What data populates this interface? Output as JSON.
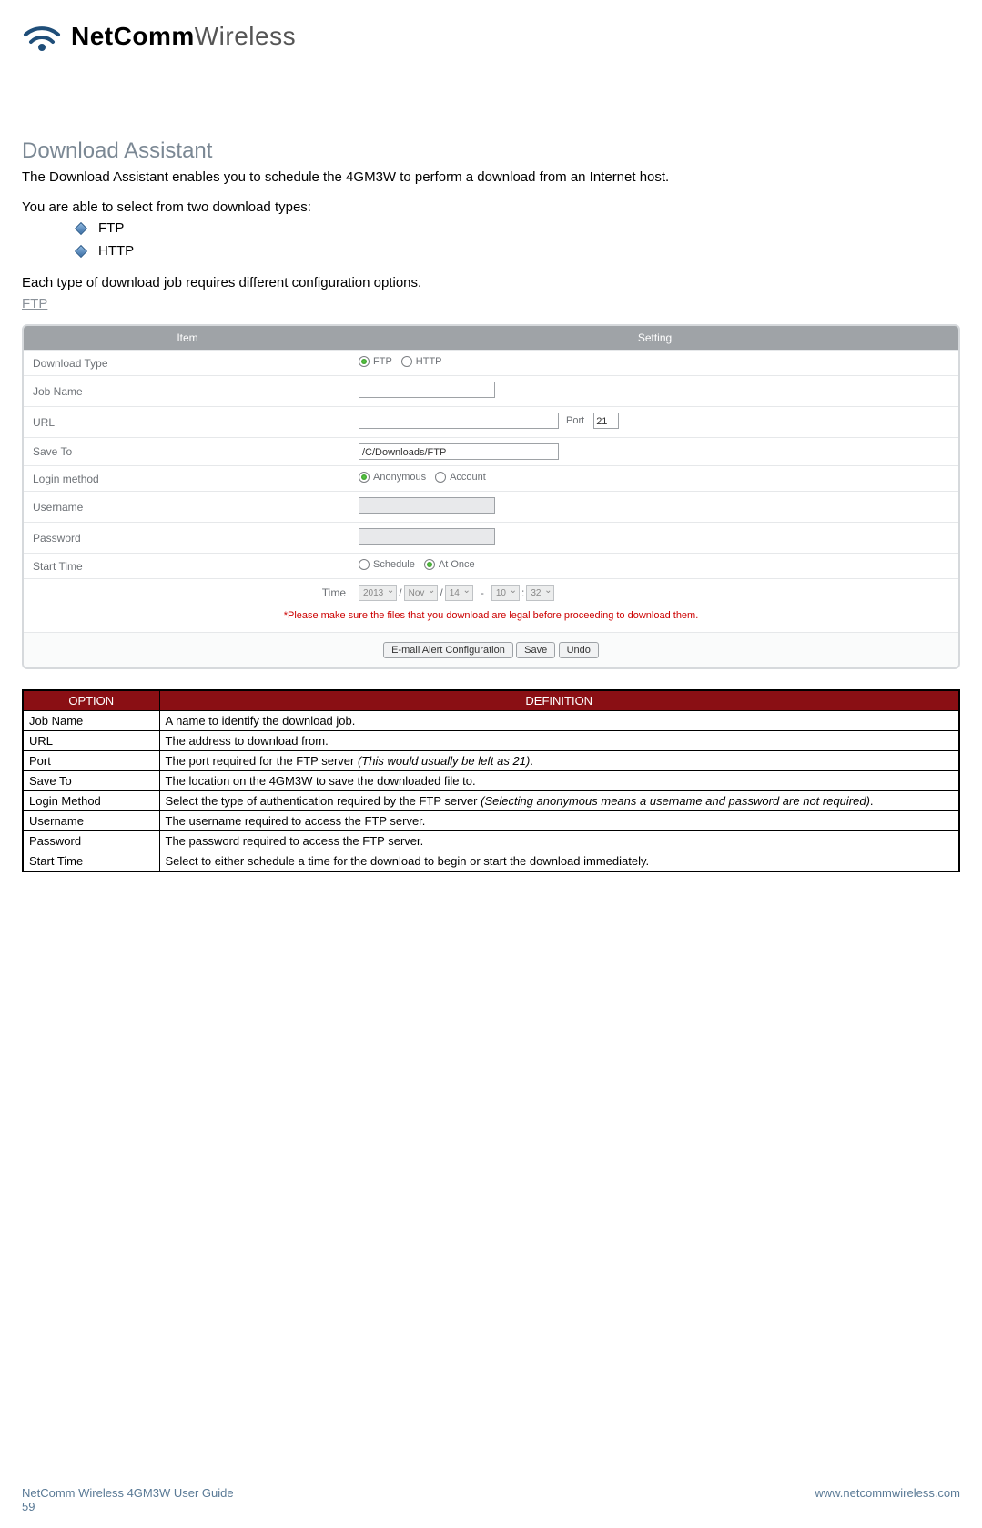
{
  "logo": {
    "bold": "NetComm",
    "light": "Wireless"
  },
  "title": "Download Assistant",
  "intro1": "The Download Assistant enables you to schedule the 4GM3W to perform a download from an Internet host.",
  "intro2": "You are able to select from two download types:",
  "bullets": [
    "FTP",
    "HTTP"
  ],
  "intro3": "Each type of download job requires different configuration options.",
  "subheading": "FTP",
  "settings": {
    "headers": {
      "item": "Item",
      "setting": "Setting"
    },
    "rows": {
      "download_type": {
        "label": "Download Type",
        "opt1": "FTP",
        "opt2": "HTTP"
      },
      "job_name": {
        "label": "Job Name"
      },
      "url": {
        "label": "URL",
        "port_label": "Port",
        "port_value": "21"
      },
      "save_to": {
        "label": "Save To",
        "value": "/C/Downloads/FTP"
      },
      "login_method": {
        "label": "Login method",
        "opt1": "Anonymous",
        "opt2": "Account"
      },
      "username": {
        "label": "Username"
      },
      "password": {
        "label": "Password"
      },
      "start_time": {
        "label": "Start Time",
        "opt1": "Schedule",
        "opt2": "At Once"
      },
      "time": {
        "label": "Time",
        "year": "2013",
        "month": "Nov",
        "day": "14",
        "hour": "10",
        "min": "32",
        "slash": "/",
        "dash": "-",
        "colon": ":"
      }
    },
    "warning": "*Please make sure the files that you download are legal before proceeding to download them.",
    "buttons": {
      "email": "E-mail Alert Configuration",
      "save": "Save",
      "undo": "Undo"
    }
  },
  "def_table": {
    "headers": {
      "option": "OPTION",
      "definition": "DEFINITION"
    },
    "rows": [
      {
        "option": "Job Name",
        "def": "A name to identify the download job."
      },
      {
        "option": "URL",
        "def": "The address to download from."
      },
      {
        "option": "Port",
        "def": "The port required for the FTP server ",
        "italic": "(This would usually be left as 21)",
        "tail": "."
      },
      {
        "option": "Save To",
        "def": "The location on the 4GM3W to save the downloaded file to."
      },
      {
        "option": "Login Method",
        "def": "Select the type of authentication required by the FTP server ",
        "italic": "(Selecting anonymous means a username and password are not required)",
        "tail": "."
      },
      {
        "option": "Username",
        "def": "The username required to access the FTP server."
      },
      {
        "option": "Password",
        "def": "The password required to access the FTP server."
      },
      {
        "option": "Start Time",
        "def": "Select to either schedule a time for the download to begin or start the download immediately."
      }
    ]
  },
  "footer": {
    "guide": "NetComm Wireless 4GM3W User Guide",
    "page": "59",
    "url": "www.netcommwireless.com"
  }
}
